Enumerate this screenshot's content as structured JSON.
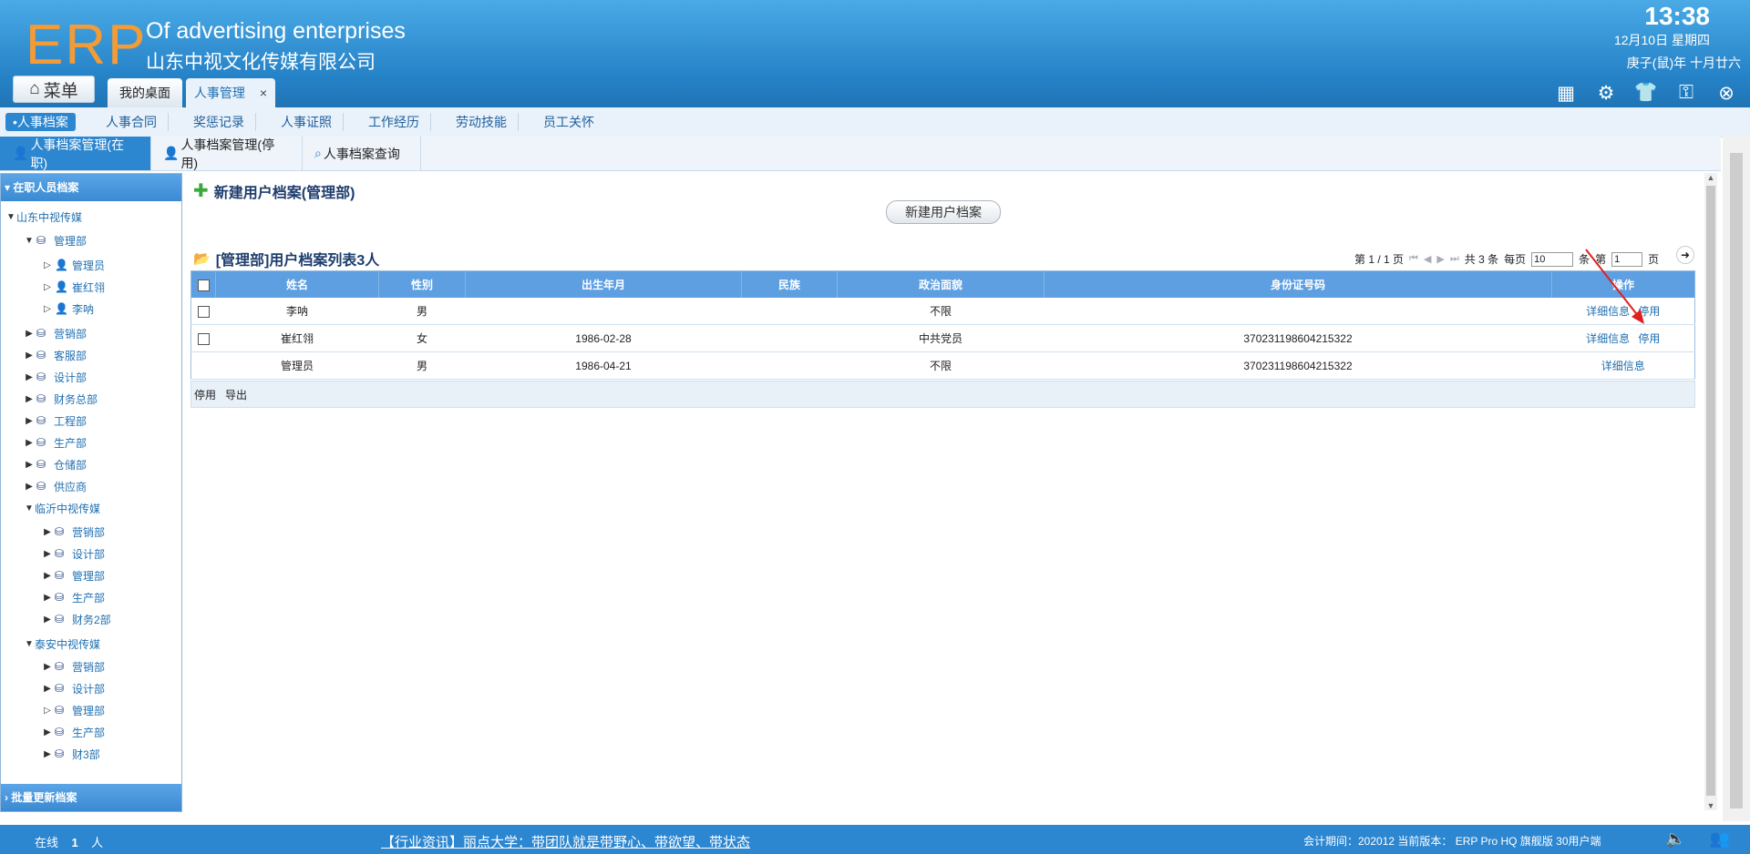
{
  "header": {
    "logo": "ERP",
    "brand_en": "Of advertising enterprises",
    "brand_cn": "山东中视文化传媒有限公司",
    "time": "13:38",
    "date": "12月10日 星期四",
    "lunar": "庚子(鼠)年 十月廿六",
    "menu_label": "菜单",
    "tabs": [
      {
        "label": "我的桌面"
      },
      {
        "label": "人事管理",
        "close": "×"
      }
    ],
    "tool_icons": [
      "add-widget-icon",
      "gear-icon",
      "shirt-icon",
      "key-icon",
      "collapse-icon"
    ]
  },
  "subnav": {
    "items": [
      "•人事档案",
      "人事合同",
      "奖惩记录",
      "人事证照",
      "工作经历",
      "劳动技能",
      "员工关怀"
    ]
  },
  "panel_tabs": [
    "人事档案管理(在职)",
    "人事档案管理(停用)",
    "人事档案查询"
  ],
  "tree": {
    "title": "在职人员档案",
    "footer": "批量更新档案",
    "nodes": [
      {
        "label": "山东中视传媒",
        "arrow": "▼"
      },
      {
        "label": "管理部",
        "arrow": "▼"
      },
      {
        "label": "管理员",
        "arrow": "▷"
      },
      {
        "label": "崔红翎",
        "arrow": "▷"
      },
      {
        "label": "李呐",
        "arrow": "▷"
      },
      {
        "label": "营销部",
        "arrow": "▶"
      },
      {
        "label": "客服部",
        "arrow": "▶"
      },
      {
        "label": "设计部",
        "arrow": "▶"
      },
      {
        "label": "财务总部",
        "arrow": "▶"
      },
      {
        "label": "工程部",
        "arrow": "▶"
      },
      {
        "label": "生产部",
        "arrow": "▶"
      },
      {
        "label": "仓储部",
        "arrow": "▶"
      },
      {
        "label": "供应商",
        "arrow": "▶"
      },
      {
        "label": "临沂中视传媒",
        "arrow": "▼"
      },
      {
        "label": "营销部",
        "arrow": "▶"
      },
      {
        "label": "设计部",
        "arrow": "▶"
      },
      {
        "label": "管理部",
        "arrow": "▶"
      },
      {
        "label": "生产部",
        "arrow": "▶"
      },
      {
        "label": "财务2部",
        "arrow": "▶"
      },
      {
        "label": "泰安中视传媒",
        "arrow": "▼"
      },
      {
        "label": "营销部",
        "arrow": "▶"
      },
      {
        "label": "设计部",
        "arrow": "▶"
      },
      {
        "label": "管理部",
        "arrow": "▷"
      },
      {
        "label": "生产部",
        "arrow": "▶"
      },
      {
        "label": "财3部",
        "arrow": "▶"
      }
    ]
  },
  "main": {
    "new_title": "新建用户档案(管理部)",
    "new_button": "新建用户档案",
    "list_title": "[管理部]用户档案列表3人",
    "pager": {
      "page_info": "第 1 / 1 页",
      "total": "共 3 条",
      "per_page_label": "每页",
      "per_page": "10",
      "unit": "条",
      "goto_label": "第",
      "goto_page": "1",
      "page_unit": "页"
    },
    "columns": [
      "姓名",
      "性别",
      "出生年月",
      "民族",
      "政治面貌",
      "身份证号码",
      "操作"
    ],
    "rows": [
      {
        "name": "李呐",
        "gender": "男",
        "birth": "",
        "ethnic": "",
        "political": "不限",
        "id": "",
        "ops": [
          "详细信息",
          "停用"
        ]
      },
      {
        "name": "崔红翎",
        "gender": "女",
        "birth": "1986-02-28",
        "ethnic": "",
        "political": "中共党员",
        "id": "370231198604215322",
        "ops": [
          "详细信息",
          "停用"
        ]
      },
      {
        "name": "管理员",
        "gender": "男",
        "birth": "1986-04-21",
        "ethnic": "",
        "political": "不限",
        "id": "370231198604215322",
        "ops": [
          "详细信息"
        ]
      }
    ],
    "footer_actions": [
      "停用",
      "导出"
    ]
  },
  "status": {
    "online_label": "在线",
    "online_count": "1",
    "online_unit": "人",
    "news": "【行业资讯】丽点大学：带团队就是带野心、带欲望、带状态",
    "info": "会计期间：202012 当前版本： ERP Pro HQ 旗舰版 30用户端"
  },
  "colors": {
    "header": "#2683c8",
    "accent": "#2c86d0",
    "logo": "#f39b37",
    "link": "#1f6fb0"
  }
}
